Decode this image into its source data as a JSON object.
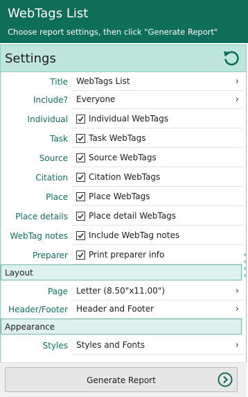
{
  "header": {
    "title": "WebTags List",
    "subtitle": "Choose report settings, then click \"Generate Report\""
  },
  "settings": {
    "label": "Settings",
    "reset_icon": "reset-icon"
  },
  "rows": {
    "title": {
      "label": "Title",
      "value": "WebTags List"
    },
    "include": {
      "label": "Include?",
      "value": "Everyone"
    },
    "individual": {
      "label": "Individual",
      "value": "Individual WebTags",
      "checked": true
    },
    "task": {
      "label": "Task",
      "value": "Task WebTags",
      "checked": true
    },
    "source": {
      "label": "Source",
      "value": "Source WebTags",
      "checked": true
    },
    "citation": {
      "label": "Citation",
      "value": "Citation WebTags",
      "checked": true
    },
    "place": {
      "label": "Place",
      "value": "Place WebTags",
      "checked": true
    },
    "place_details": {
      "label": "Place details",
      "value": "Place detail WebTags",
      "checked": true
    },
    "webtag_notes": {
      "label": "WebTag notes",
      "value": "Include WebTag notes",
      "checked": true
    },
    "preparer": {
      "label": "Preparer",
      "value": "Print preparer info",
      "checked": true
    }
  },
  "layout": {
    "section_label": "Layout",
    "page": {
      "label": "Page",
      "value": "Letter (8.50\"x11.00\")"
    },
    "header_footer": {
      "label": "Header/Footer",
      "value": "Header and Footer"
    }
  },
  "appearance": {
    "section_label": "Appearance",
    "styles": {
      "label": "Styles",
      "value": "Styles and Fonts"
    }
  },
  "footer": {
    "generate_label": "Generate Report"
  },
  "colors": {
    "brand": "#0f6e5a",
    "settings_bar": "#bfe6dd",
    "section_bg": "#dff1ec"
  }
}
